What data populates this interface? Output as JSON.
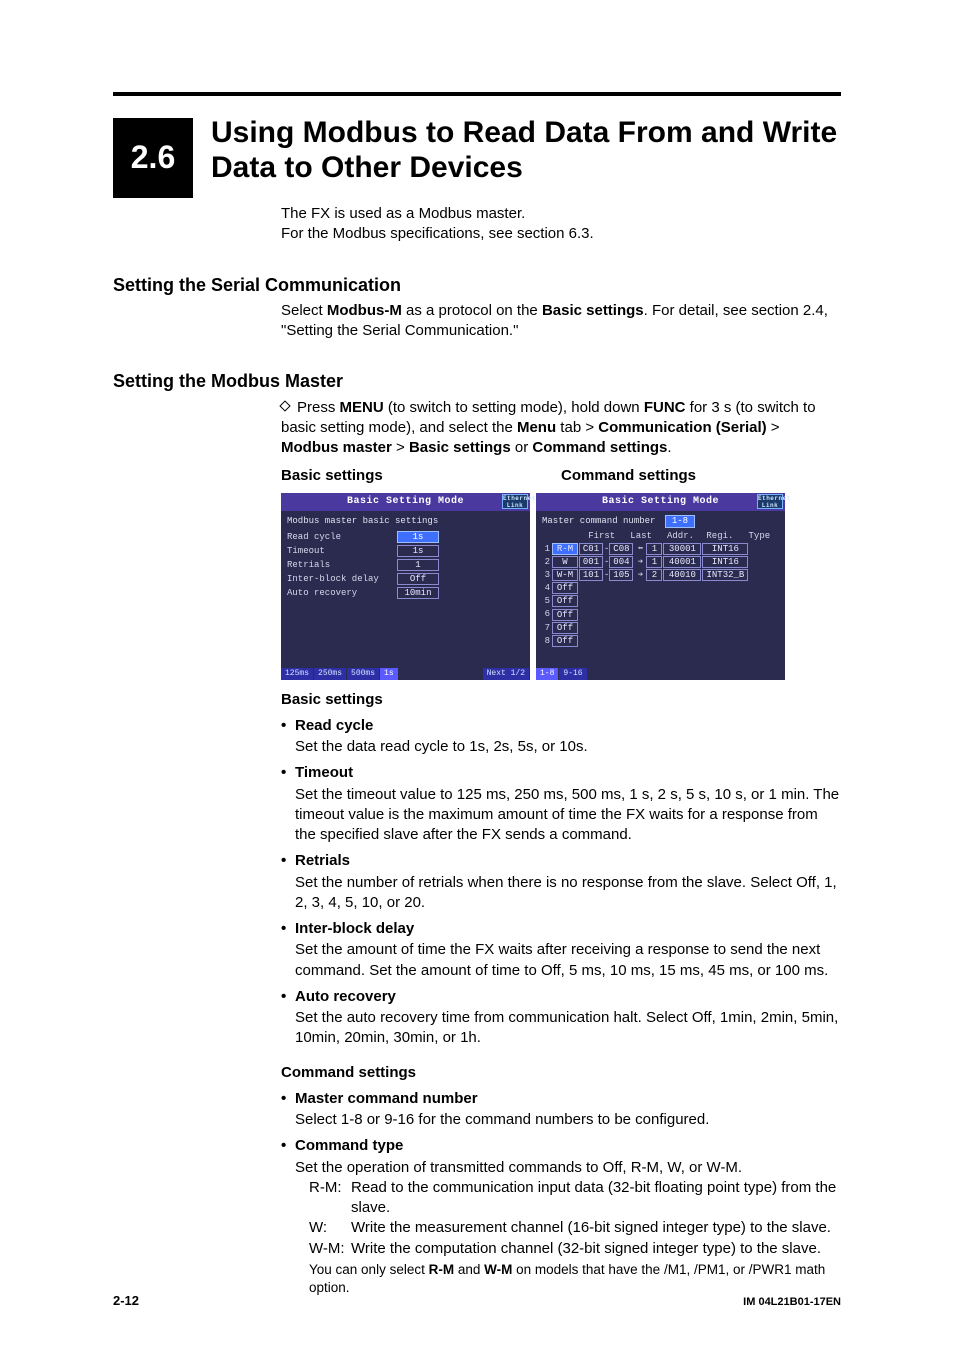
{
  "header": {
    "number": "2.6",
    "title": "Using Modbus to Read Data From and Write Data to Other Devices"
  },
  "intro": {
    "line1": "The FX is used as a Modbus master.",
    "line2": "For the Modbus specifications, see section 6.3."
  },
  "serial": {
    "heading": "Setting the Serial Communication",
    "body_pre": "Select ",
    "modbus_m": "Modbus-M",
    "body_mid": " as a protocol on the ",
    "basic_settings": "Basic settings",
    "body_post": ". For detail, see section 2.4, \"Setting the Serial Communication.\""
  },
  "master": {
    "heading": "Setting the Modbus Master",
    "step_pre": "Press ",
    "menu": "MENU",
    "step_mid1": " (to switch to setting mode), hold down ",
    "func": "FUNC",
    "step_mid2": " for 3 s (to switch to basic setting mode), and select the ",
    "menu_tab": "Menu",
    "gt1": " tab > ",
    "comm": "Communication (Serial)",
    "gt2": " > ",
    "modbus_master": "Modbus master",
    "gt3": " > ",
    "basic": "Basic settings",
    "or": " or ",
    "command": "Command settings",
    "period": "."
  },
  "screens": {
    "basic_label": "Basic settings",
    "command_label": "Command settings",
    "title": "Basic Setting Mode",
    "eth": "Ethernet Link",
    "basic": {
      "subtitle": "Modbus master basic settings",
      "rows": [
        {
          "label": "Read cycle",
          "value": "1s",
          "sel": true
        },
        {
          "label": "Timeout",
          "value": "1s"
        },
        {
          "label": "Retrials",
          "value": "1"
        },
        {
          "label": "Inter-block delay",
          "value": "Off"
        },
        {
          "label": "Auto recovery",
          "value": "10min"
        }
      ],
      "tabs": [
        "125ms",
        "250ms",
        "500ms",
        "1s"
      ],
      "tab_sel": 3,
      "next": "Next 1/2"
    },
    "cmd": {
      "subtitle_pre": "Master command number",
      "subtitle_band": "1-8",
      "headers": [
        "First",
        "Last",
        "Addr.",
        "Regi.",
        "Type"
      ],
      "rows": [
        {
          "n": "1",
          "t": "R-M",
          "f": "C01",
          "l": "C08",
          "ar": "⬅",
          "a": "1",
          "r": "30001",
          "ty": "INT16",
          "sel": true
        },
        {
          "n": "2",
          "t": "W",
          "f": "001",
          "l": "004",
          "ar": "➔",
          "a": "1",
          "r": "40001",
          "ty": "INT16"
        },
        {
          "n": "3",
          "t": "W-M",
          "f": "101",
          "l": "105",
          "ar": "➔",
          "a": "2",
          "r": "40010",
          "ty": "INT32_B"
        },
        {
          "n": "4",
          "t": "Off"
        },
        {
          "n": "5",
          "t": "Off"
        },
        {
          "n": "6",
          "t": "Off"
        },
        {
          "n": "7",
          "t": "Off"
        },
        {
          "n": "8",
          "t": "Off"
        }
      ],
      "tabs": [
        "1-8",
        "9-16"
      ],
      "tab_sel": 0
    }
  },
  "basic_section": {
    "heading": "Basic settings",
    "items": [
      {
        "label": "Read cycle",
        "body": "Set the data read cycle to 1s, 2s, 5s, or 10s."
      },
      {
        "label": "Timeout",
        "body": "Set the timeout value to 125 ms, 250 ms, 500 ms, 1 s, 2 s, 5 s, 10 s, or 1 min. The timeout value is the maximum amount of time the FX waits for a response from the specified slave after the FX sends a command."
      },
      {
        "label": "Retrials",
        "body": "Set the number of retrials when there is no response from the slave. Select Off, 1, 2, 3, 4, 5, 10, or 20."
      },
      {
        "label": "Inter-block delay",
        "body": "Set the amount of time the FX waits after receiving a response to send the next command. Set the amount of time to Off, 5 ms, 10 ms, 15 ms, 45 ms, or 100 ms."
      },
      {
        "label": "Auto recovery",
        "body": "Set the auto recovery time from communication halt. Select Off, 1min, 2min, 5min, 10min, 20min, 30min, or 1h."
      }
    ]
  },
  "command_section": {
    "heading": "Command settings",
    "mcn": {
      "label": "Master command number",
      "body": "Select 1-8 or 9-16 for the command numbers to be configured."
    },
    "ctype": {
      "label": "Command type",
      "body": "Set the operation of transmitted commands to Off, R-M, W, or W-M.",
      "rows": [
        {
          "tag": "R-M:",
          "desc": "Read to the communication input data (32-bit floating point type) from the slave."
        },
        {
          "tag": "W:",
          "desc": "Write the measurement channel (16-bit signed integer type) to the slave."
        },
        {
          "tag": "W-M:",
          "desc": "Write the computation channel (32-bit signed integer type) to the slave."
        }
      ],
      "note_pre": "You can only select ",
      "note_rm": "R-M",
      "note_and": " and ",
      "note_wm": "W-M",
      "note_post": " on models that have the /M1, /PM1, or /PWR1 math option."
    }
  },
  "footer": {
    "left": "2-12",
    "right": "IM 04L21B01-17EN"
  }
}
